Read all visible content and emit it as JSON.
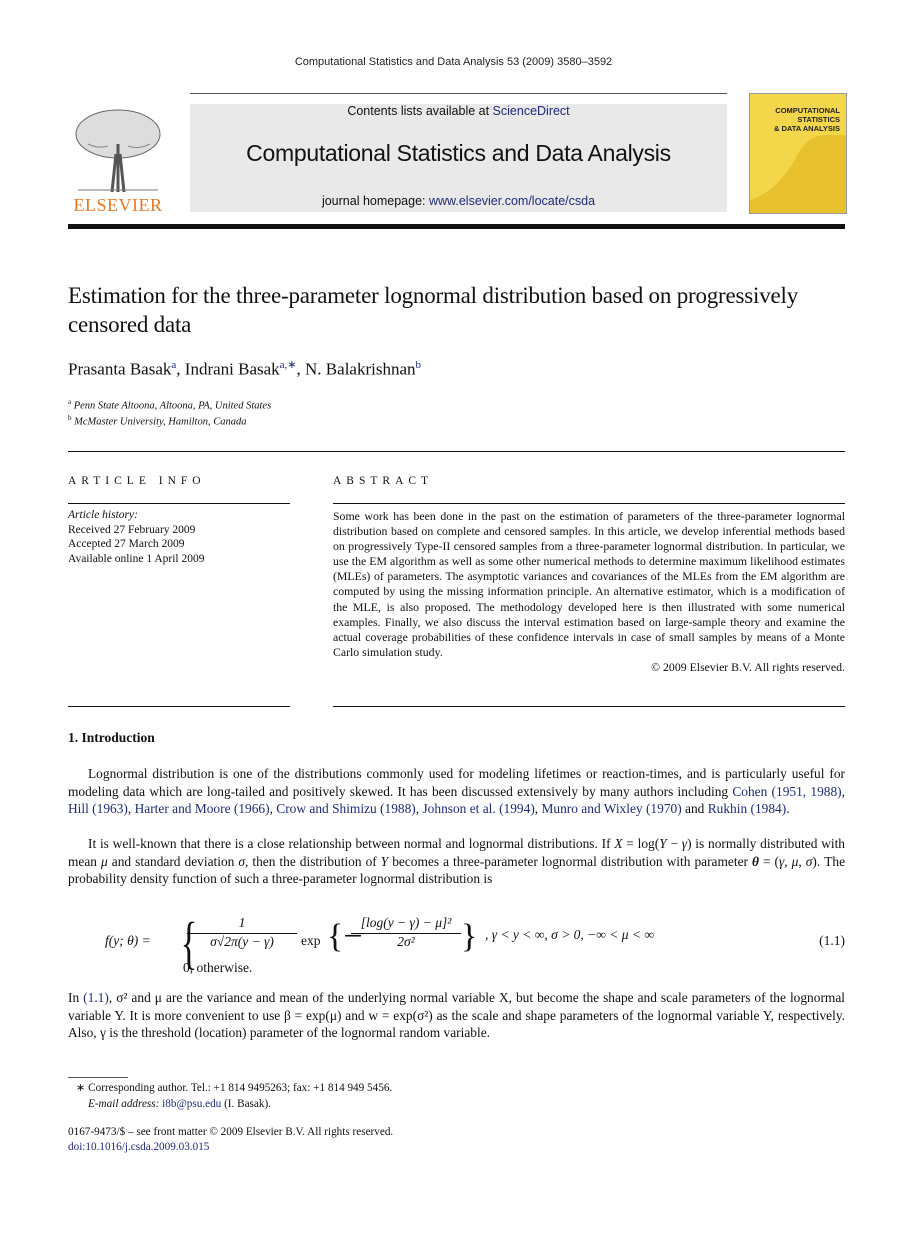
{
  "running_head": "Computational Statistics and Data Analysis 53 (2009) 3580–3592",
  "banner": {
    "contents_prefix": "Contents lists available at ",
    "contents_link": "ScienceDirect",
    "journal_title": "Computational Statistics and Data Analysis",
    "homepage_prefix": "journal homepage: ",
    "homepage_link": "www.elsevier.com/locate/csda"
  },
  "publisher_logo": {
    "wordmark": "ELSEVIER",
    "color": "#e87722"
  },
  "cover": {
    "lines": [
      "COMPUTATIONAL",
      "STATISTICS",
      "& DATA ANALYSIS"
    ],
    "color": "#f4d64a"
  },
  "article": {
    "title": "Estimation for the three-parameter lognormal distribution based on progressively censored data",
    "authors": [
      {
        "name": "Prasanta Basak",
        "sup": "a"
      },
      {
        "name": "Indrani Basak",
        "sup": "a,∗"
      },
      {
        "name": "N. Balakrishnan",
        "sup": "b"
      }
    ],
    "affiliations": [
      {
        "sup": "a",
        "text": "Penn State Altoona, Altoona, PA, United States"
      },
      {
        "sup": "b",
        "text": "McMaster University, Hamilton, Canada"
      }
    ]
  },
  "article_info": {
    "heading": "ARTICLE INFO",
    "history_label": "Article history:",
    "received": "Received 27 February 2009",
    "accepted": "Accepted 27 March 2009",
    "online": "Available online 1 April 2009"
  },
  "abstract": {
    "heading": "ABSTRACT",
    "text": "Some work has been done in the past on the estimation of parameters of the three-parameter lognormal distribution based on complete and censored samples. In this article, we develop inferential methods based on progressively Type-II censored samples from a three-parameter lognormal distribution. In particular, we use the EM algorithm as well as some other numerical methods to determine maximum likelihood estimates (MLEs) of parameters. The asymptotic variances and covariances of the MLEs from the EM algorithm are computed by using the missing information principle. An alternative estimator, which is a modification of the MLE, is also proposed. The methodology developed here is then illustrated with some numerical examples. Finally, we also discuss the interval estimation based on large-sample theory and examine the actual coverage probabilities of these confidence intervals in case of small samples by means of a Monte Carlo simulation study.",
    "copyright": "© 2009 Elsevier B.V. All rights reserved."
  },
  "introduction": {
    "heading": "1.  Introduction",
    "p1_text": "Lognormal distribution is one of the distributions commonly used for modeling lifetimes or reaction-times, and is particularly useful for modeling data which are long-tailed and positively skewed. It has been discussed extensively by many authors including ",
    "p1_refs": [
      "Cohen (1951, 1988)",
      "Hill (1963)",
      "Harter and Moore (1966)",
      "Crow and Shimizu (1988)",
      "Johnson et al. (1994)",
      "Munro and Wixley (1970)",
      "Rukhin (1984)"
    ],
    "p2_a": "It is well-known that there is a close relationship between normal and lognormal distributions. If ",
    "p2_b": " is normally distributed with mean ",
    "p2_c": " and standard deviation ",
    "p2_d": ", then the distribution of ",
    "p2_e": " becomes a three-parameter lognormal distribution with parameter ",
    "p2_f": ". The probability density function of such a three-parameter lognormal distribution is",
    "equation": {
      "lhs": "f(y; θ) =",
      "frac1_num": "1",
      "frac1_den": "σ√2π(y − γ)",
      "exp": "exp",
      "frac2_num": "[log(y − γ) − μ]²",
      "frac2_den": "2σ²",
      "cond": ",    γ < y < ∞, σ > 0, −∞ < μ < ∞",
      "otherwise": "0,    otherwise.",
      "label": "(1.1)"
    },
    "p3_a": "In ",
    "p3_ref": "(1.1)",
    "p3_b": ", σ² and μ are the variance and mean of the underlying normal variable X, but become the shape and scale parameters of the lognormal variable Y. It is more convenient to use β = exp(μ) and w = exp(σ²) as the scale and shape parameters of the lognormal variable Y, respectively. Also, γ is the threshold (location) parameter of the lognormal random variable."
  },
  "footnotes": {
    "corresponding": "∗  Corresponding author. Tel.: +1 814 9495263; fax: +1 814 949 5456.",
    "email_label": "E-mail address: ",
    "email": "i8b@psu.edu",
    "email_suffix": " (I. Basak).",
    "issn": "0167-9473/$ – see front matter © 2009 Elsevier B.V. All rights reserved.",
    "doi": "doi:10.1016/j.csda.2009.03.015"
  }
}
